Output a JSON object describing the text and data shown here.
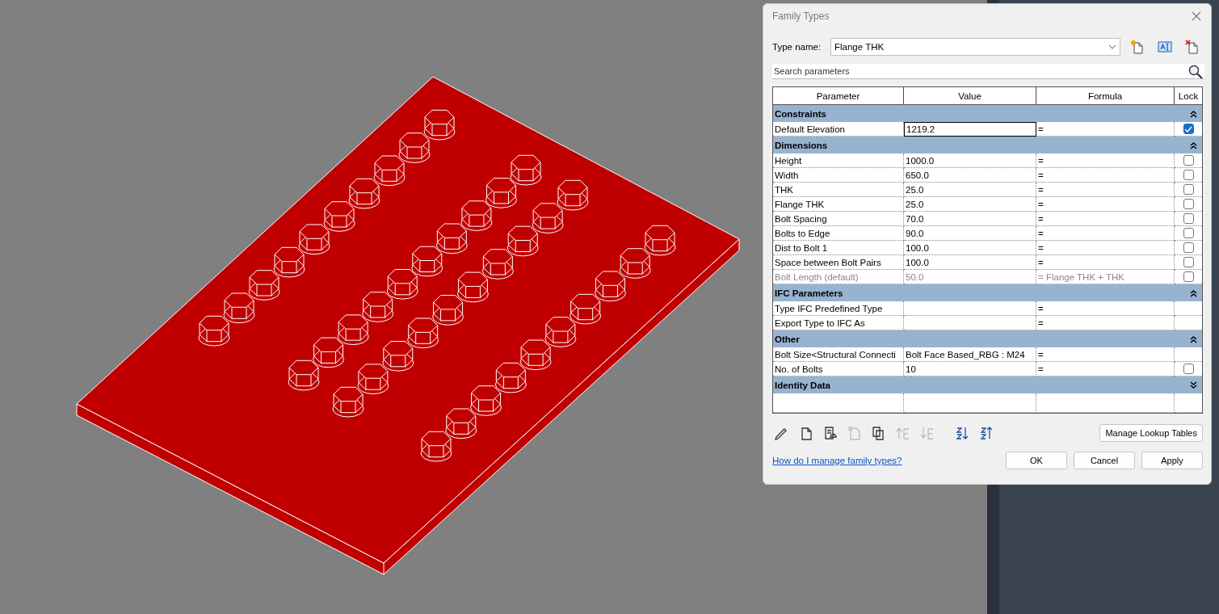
{
  "dialog": {
    "title": "Family Types",
    "type_name_label": "Type name:",
    "type_name": "Flange THK",
    "search": {
      "placeholder": "Search parameters"
    },
    "columns": [
      "Parameter",
      "Value",
      "Formula",
      "Lock"
    ],
    "groups": [
      {
        "name": "Constraints",
        "expanded": true,
        "rows": [
          {
            "parameter": "Default Elevation",
            "value": "1219.2",
            "formula": "=",
            "lockable": true,
            "locked": true,
            "editing": true,
            "disabled": false
          }
        ]
      },
      {
        "name": "Dimensions",
        "expanded": true,
        "rows": [
          {
            "parameter": "Height",
            "value": "1000.0",
            "formula": "=",
            "lockable": true,
            "locked": false,
            "editing": false,
            "disabled": false
          },
          {
            "parameter": "Width",
            "value": "650.0",
            "formula": "=",
            "lockable": true,
            "locked": false,
            "editing": false,
            "disabled": false
          },
          {
            "parameter": "THK",
            "value": "25.0",
            "formula": "=",
            "lockable": true,
            "locked": false,
            "editing": false,
            "disabled": false
          },
          {
            "parameter": "Flange THK",
            "value": "25.0",
            "formula": "=",
            "lockable": true,
            "locked": false,
            "editing": false,
            "disabled": false
          },
          {
            "parameter": "Bolt Spacing",
            "value": "70.0",
            "formula": "=",
            "lockable": true,
            "locked": false,
            "editing": false,
            "disabled": false
          },
          {
            "parameter": "Bolts to Edge",
            "value": "90.0",
            "formula": "=",
            "lockable": true,
            "locked": false,
            "editing": false,
            "disabled": false
          },
          {
            "parameter": "Dist to Bolt 1",
            "value": "100.0",
            "formula": "=",
            "lockable": true,
            "locked": false,
            "editing": false,
            "disabled": false
          },
          {
            "parameter": "Space between Bolt Pairs",
            "value": "100.0",
            "formula": "=",
            "lockable": true,
            "locked": false,
            "editing": false,
            "disabled": false
          },
          {
            "parameter": "Bolt Length (default)",
            "value": "50.0",
            "formula": "= Flange THK + THK",
            "lockable": true,
            "locked": false,
            "editing": false,
            "disabled": true
          }
        ]
      },
      {
        "name": "IFC Parameters",
        "expanded": true,
        "rows": [
          {
            "parameter": "Type IFC Predefined Type",
            "formula": "=",
            "lockable": false,
            "editing": false,
            "disabled": false
          },
          {
            "parameter": "Export Type to IFC As",
            "formula": "=",
            "lockable": false,
            "editing": false,
            "disabled": false
          }
        ]
      },
      {
        "name": "Other",
        "expanded": true,
        "rows": [
          {
            "parameter": "Bolt Size<Structural Connecti",
            "value": "Bolt Face Based_RBG : M24",
            "formula": "=",
            "lockable": false,
            "editing": false,
            "disabled": false
          },
          {
            "parameter": "No. of Bolts",
            "value": "10",
            "formula": "=",
            "lockable": true,
            "locked": false,
            "editing": false,
            "disabled": false
          }
        ]
      },
      {
        "name": "Identity Data",
        "expanded": false
      }
    ],
    "tools": [
      {
        "kind": "edit",
        "disabled": false
      },
      {
        "kind": "new",
        "disabled": false
      },
      {
        "kind": "shared",
        "disabled": false
      },
      {
        "kind": "delete",
        "disabled": true
      },
      {
        "kind": "copy",
        "disabled": false
      },
      {
        "kind": "up",
        "disabled": true
      },
      {
        "kind": "down",
        "disabled": true
      },
      {
        "kind": "sort-asc",
        "disabled": false
      },
      {
        "kind": "sort-desc",
        "disabled": false
      }
    ],
    "lookup_button": "Manage Lookup Tables",
    "help_link": "How do I manage family types?",
    "buttons": [
      "OK",
      "Cancel",
      "Apply"
    ]
  }
}
